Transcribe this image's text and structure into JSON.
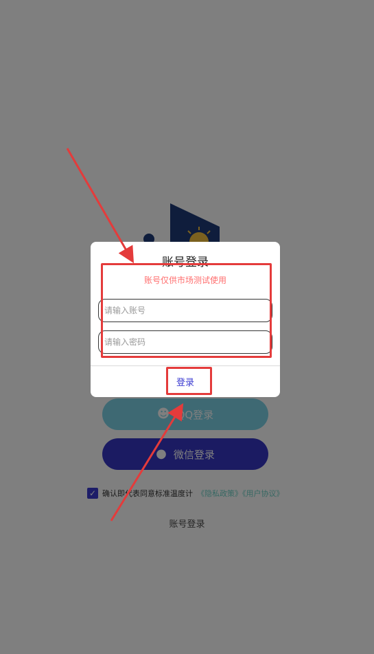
{
  "background": {
    "qq_login_label": "QQ登录",
    "qq_icon": "qq-penguin-icon",
    "wechat_login_label": "微信登录",
    "wechat_icon": "wechat-bubbles-icon",
    "agreement_text": "确认即代表同意标准温度计",
    "agreement_links": "《隐私政策》《用户协议》",
    "account_login_link": "账号登录",
    "checkbox_checked": true
  },
  "dialog": {
    "title": "账号登录",
    "notice": "账号仅供市场测试使用",
    "account_placeholder": "请输入账号",
    "password_placeholder": "请输入密码",
    "login_button": "登录"
  },
  "colors": {
    "wechat_button": "#3737c4",
    "qq_button": "#7dd3e6",
    "notice_red": "#ff6e6e",
    "link_blue": "#3b3bd1",
    "annotation_red": "#e43b3b"
  }
}
